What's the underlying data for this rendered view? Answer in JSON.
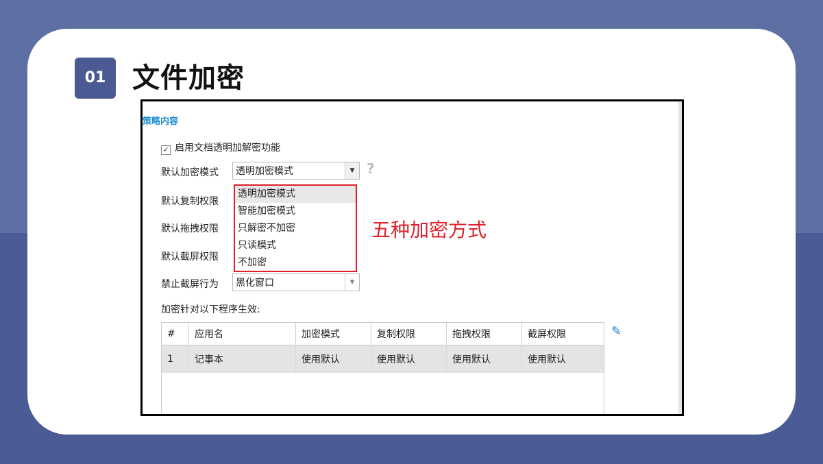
{
  "slide": {
    "number": "01",
    "title": "文件加密",
    "annotation": "五种加密方式"
  },
  "panel": {
    "section_title": "策略内容",
    "enable_checkbox": {
      "label": "启用文档透明加解密功能",
      "checked": true,
      "check_glyph": "✓"
    },
    "labels": {
      "default_mode": "默认加密模式",
      "copy": "默认复制权限",
      "drag": "默认拖拽权限",
      "screenshot": "默认截屏权限",
      "forbid_screenshot": "禁止截屏行为"
    },
    "mode_select": {
      "value": "透明加密模式"
    },
    "mode_options": [
      "透明加密模式",
      "智能加密模式",
      "只解密不加密",
      "只读模式",
      "不加密"
    ],
    "forbid_select": {
      "value": "黑化窗口"
    },
    "help_icon": "?",
    "program_label": "加密针对以下程序生效:",
    "table": {
      "headers": [
        "#",
        "应用名",
        "加密模式",
        "复制权限",
        "拖拽权限",
        "截屏权限"
      ],
      "rows": [
        [
          "1",
          "记事本",
          "使用默认",
          "使用默认",
          "使用默认",
          "使用默认"
        ]
      ]
    },
    "edit_icon": "pencil-icon"
  },
  "colors": {
    "background": "#4a5b95",
    "accent_red": "#e0202a",
    "link_blue": "#1c8ccf"
  }
}
